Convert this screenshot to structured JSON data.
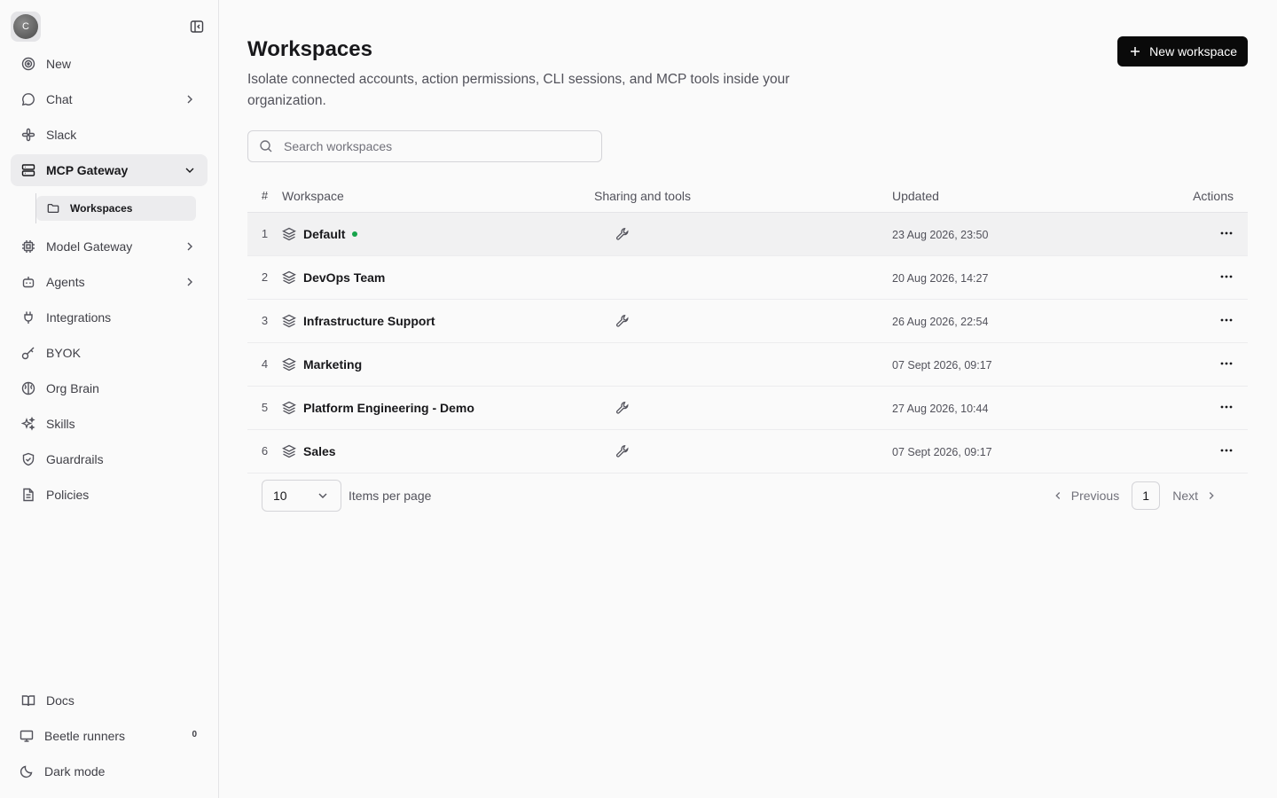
{
  "sidebar": {
    "avatar_initial": "C",
    "items": [
      {
        "label": "New",
        "icon": "target-icon"
      },
      {
        "label": "Chat",
        "icon": "chat-bubble-icon"
      },
      {
        "label": "Slack",
        "icon": "slack-icon"
      },
      {
        "label": "MCP Gateway",
        "icon": "server-icon"
      },
      {
        "label": "Model Gateway",
        "icon": "cpu-icon"
      },
      {
        "label": "Agents",
        "icon": "bot-icon"
      },
      {
        "label": "Integrations",
        "icon": "plug-icon"
      },
      {
        "label": "BYOK",
        "icon": "key-icon"
      },
      {
        "label": "Org Brain",
        "icon": "brain-icon"
      },
      {
        "label": "Skills",
        "icon": "sparkles-icon"
      },
      {
        "label": "Guardrails",
        "icon": "shield-icon"
      },
      {
        "label": "Policies",
        "icon": "document-icon"
      }
    ],
    "subitem": {
      "label": "Workspaces",
      "icon": "folder-icon"
    },
    "bottom": [
      {
        "label": "Docs",
        "icon": "book-icon"
      },
      {
        "label": "Beetle runners",
        "icon": "monitor-icon",
        "badge": "0"
      },
      {
        "label": "Dark mode",
        "icon": "moon-icon"
      }
    ]
  },
  "header": {
    "title": "Workspaces",
    "subtitle": "Isolate connected accounts, action permissions, CLI sessions, and MCP tools inside your organization.",
    "new_button": "New workspace"
  },
  "search": {
    "placeholder": "Search workspaces",
    "value": ""
  },
  "table": {
    "columns": [
      "#",
      "Workspace",
      "Sharing and tools",
      "Updated",
      "Actions"
    ],
    "rows": [
      {
        "num": "1",
        "name": "Default",
        "active_dot": true,
        "tools": true,
        "updated": "23 Aug 2026, 23:50"
      },
      {
        "num": "2",
        "name": "DevOps Team",
        "active_dot": false,
        "tools": false,
        "updated": "20 Aug 2026, 14:27"
      },
      {
        "num": "3",
        "name": "Infrastructure Support",
        "active_dot": false,
        "tools": true,
        "updated": "26 Aug 2026, 22:54"
      },
      {
        "num": "4",
        "name": "Marketing",
        "active_dot": false,
        "tools": false,
        "updated": "07 Sept 2026, 09:17"
      },
      {
        "num": "5",
        "name": "Platform Engineering - Demo",
        "active_dot": false,
        "tools": true,
        "updated": "27 Aug 2026, 10:44"
      },
      {
        "num": "6",
        "name": "Sales",
        "active_dot": false,
        "tools": true,
        "updated": "07 Sept 2026, 09:17"
      }
    ]
  },
  "pagination": {
    "per_page": "10",
    "per_page_label": "Items per page",
    "previous": "Previous",
    "current": "1",
    "next": "Next"
  },
  "colors": {
    "accent": "#0a0a0a",
    "active_dot": "#16a34a",
    "highlight_row": "#f1f1f2"
  }
}
